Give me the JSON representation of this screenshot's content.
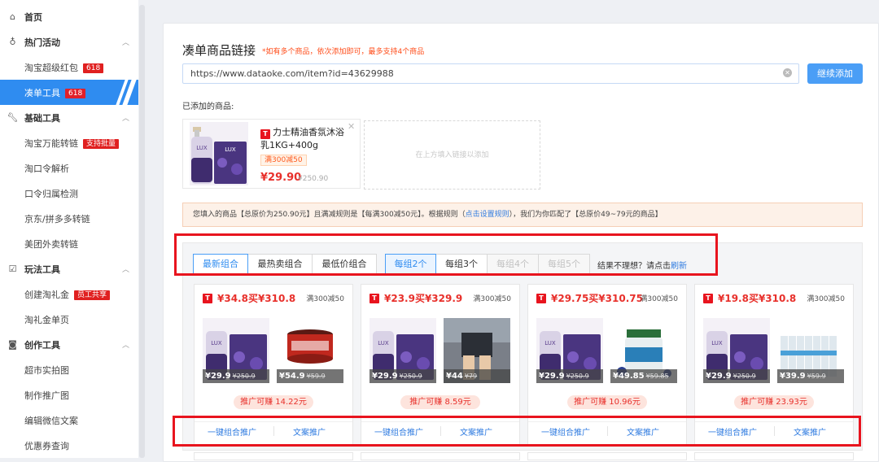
{
  "sidebar": {
    "items": [
      {
        "label": "首页",
        "icon": "home-icon",
        "type": "top"
      },
      {
        "label": "热门活动",
        "icon": "flame-icon",
        "type": "header"
      },
      {
        "label": "淘宝超级红包",
        "badge": "618",
        "type": "sub"
      },
      {
        "label": "凑单工具",
        "badge": "618",
        "type": "sub",
        "active": true
      },
      {
        "label": "基础工具",
        "icon": "wrench-icon",
        "type": "header"
      },
      {
        "label": "淘宝万能转链",
        "badge": "支持批量",
        "type": "sub"
      },
      {
        "label": "淘口令解析",
        "type": "sub"
      },
      {
        "label": "口令归属检测",
        "type": "sub"
      },
      {
        "label": "京东/拼多多转链",
        "type": "sub"
      },
      {
        "label": "美团外卖转链",
        "type": "sub"
      },
      {
        "label": "玩法工具",
        "icon": "checkbox-icon",
        "type": "header"
      },
      {
        "label": "创建淘礼金",
        "badge": "员工共享",
        "type": "sub"
      },
      {
        "label": "淘礼金单页",
        "type": "sub"
      },
      {
        "label": "创作工具",
        "icon": "camera-icon",
        "type": "header"
      },
      {
        "label": "超市实拍图",
        "type": "sub"
      },
      {
        "label": "制作推广图",
        "type": "sub"
      },
      {
        "label": "编辑微信文案",
        "type": "sub"
      },
      {
        "label": "优惠券查询",
        "type": "sub"
      }
    ]
  },
  "main": {
    "title": "凑单商品链接",
    "title_note": "*如有多个商品，依次添加即可，最多支持4个商品",
    "url_value": "https://www.dataoke.com/item?id=43629988",
    "add_button": "继续添加",
    "added_label": "已添加的商品:",
    "added_product": {
      "name": "力士精油香氛沐浴乳1KG+400g",
      "coupon": "满300减50",
      "price": "¥29.90",
      "original_price": "¥250.90"
    },
    "placeholder_text": "在上方填入链接以添加",
    "notice": {
      "part1": "您填入的商品【总原价为250.90元】且满减规则是【每满300减50元】。根据规则（",
      "link": "点击设置规则",
      "part2": "），我们为你匹配了【总原价49~79元的商品】"
    },
    "sort_tabs": [
      "最新组合",
      "最热卖组合",
      "最低价组合"
    ],
    "group_tabs": [
      "每组2个",
      "每组3个",
      "每组4个",
      "每组5个"
    ],
    "hint_text": "结果不理想？请点击",
    "hint_link": "刷新"
  },
  "combos": [
    {
      "price_text": "¥34.8买¥310.8",
      "rule": "满300减50",
      "item1_price": "¥29.9",
      "item1_orig": "¥250.9",
      "item2_price": "¥54.9",
      "item2_orig": "¥59.9",
      "earn": "推广可赚 14.22元",
      "btn1": "一键组合推广",
      "btn2": "文案推广"
    },
    {
      "price_text": "¥23.9买¥329.9",
      "rule": "满300减50",
      "item1_price": "¥29.9",
      "item1_orig": "¥250.9",
      "item2_price": "¥44",
      "item2_orig": "¥79",
      "earn": "推广可赚 8.59元",
      "btn1": "一键组合推广",
      "btn2": "文案推广"
    },
    {
      "price_text": "¥29.75买¥310.75",
      "rule": "满300减50",
      "item1_price": "¥29.9",
      "item1_orig": "¥250.9",
      "item2_price": "¥49.85",
      "item2_orig": "¥59.85",
      "earn": "推广可赚 10.96元",
      "btn1": "一键组合推广",
      "btn2": "文案推广"
    },
    {
      "price_text": "¥19.8买¥310.8",
      "rule": "满300减50",
      "item1_price": "¥29.9",
      "item1_orig": "¥250.9",
      "item2_price": "¥39.9",
      "item2_orig": "¥59.9",
      "earn": "推广可赚 23.93元",
      "btn1": "一键组合推广",
      "btn2": "文案推广"
    }
  ],
  "colors": {
    "accent": "#2f8cf0",
    "price_red": "#e8302b",
    "highlight_box": "#e8141e"
  }
}
